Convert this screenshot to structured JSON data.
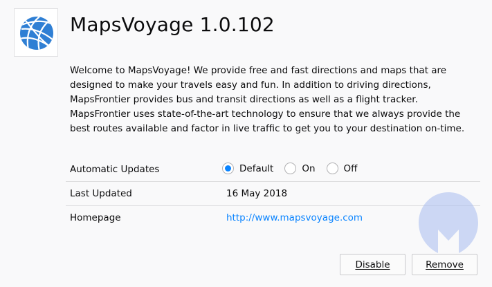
{
  "addon": {
    "name": "MapsVoyage",
    "version": "1.0.102",
    "title": "MapsVoyage 1.0.102",
    "description": "Welcome to MapsVoyage! We provide free and fast directions and maps that are designed to make your travels easy and fun. In addition to driving directions, MapsFrontier provides bus and transit directions as well as a flight tracker. MapsFrontier uses state-of-the-art technology to ensure that we always provide the best routes available and factor in live traffic to get you to your destination on-time.",
    "icon": "globe-icon"
  },
  "details": {
    "automatic_updates": {
      "label": "Automatic Updates",
      "options": [
        "Default",
        "On",
        "Off"
      ],
      "selected": "Default"
    },
    "last_updated": {
      "label": "Last Updated",
      "value": "16 May 2018"
    },
    "homepage": {
      "label": "Homepage",
      "value": "http://www.mapsvoyage.com"
    }
  },
  "actions": {
    "disable_label": "Disable",
    "remove_label": "Remove"
  },
  "colors": {
    "background": "#f9f9fa",
    "link": "#0a84ff",
    "radio_selected": "#0a84ff",
    "watermark": "#a8bdf0"
  }
}
